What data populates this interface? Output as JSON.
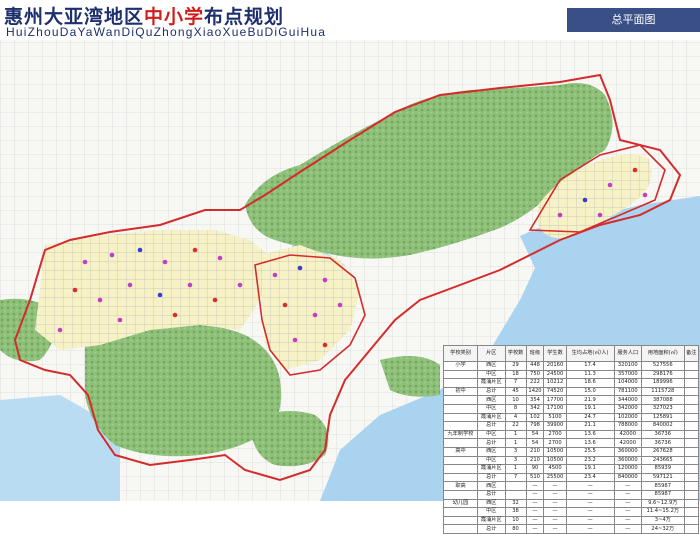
{
  "header": {
    "title_part1": "惠州大亚湾地区",
    "title_highlight": "中小学",
    "title_part2": "布点规划",
    "pinyin": "HuiZhouDaYaWanDiQuZhongXiaoXueBuDiGuiHua",
    "view_tab": "总平面图"
  },
  "colors": {
    "title": "#1e2f6e",
    "highlight": "#d21d1d",
    "boundary": "#d42b2b",
    "hills": "#7bb267",
    "water": "#a9d3ef",
    "built_area": "#f3efb1",
    "view_tab": "#3a4f86"
  },
  "legend_table": {
    "headers": [
      "学校类别",
      "片区",
      "学校数",
      "班级",
      "学生数",
      "生均占地(㎡/人)",
      "服务人口",
      "用地面积(㎡)",
      "备注"
    ],
    "rows": [
      {
        "category": "小学",
        "cells": [
          "西区",
          "29",
          "448",
          "20160",
          "17.4",
          "320100",
          "527556",
          ""
        ]
      },
      {
        "category": "",
        "cells": [
          "中区",
          "18",
          "750",
          "24500",
          "11.3",
          "357000",
          "298176",
          ""
        ]
      },
      {
        "category": "",
        "cells": [
          "霞涌片区",
          "7",
          "222",
          "10212",
          "18.6",
          "104000",
          "189996",
          ""
        ]
      },
      {
        "category": "初中",
        "cells": [
          "总计",
          "45",
          "1420",
          "74520",
          "15.0",
          "781100",
          "1115728",
          ""
        ]
      },
      {
        "category": "",
        "cells": [
          "西区",
          "10",
          "354",
          "17700",
          "21.9",
          "344000",
          "387088",
          ""
        ]
      },
      {
        "category": "",
        "cells": [
          "中区",
          "8",
          "342",
          "17100",
          "19.1",
          "342000",
          "327023",
          ""
        ]
      },
      {
        "category": "",
        "cells": [
          "霞涌片区",
          "4",
          "102",
          "5100",
          "24.7",
          "102000",
          "125891",
          ""
        ]
      },
      {
        "category": "",
        "cells": [
          "总计",
          "22",
          "798",
          "39900",
          "21.1",
          "788000",
          "840002",
          ""
        ]
      },
      {
        "category": "九年制学校",
        "cells": [
          "中区",
          "1",
          "54",
          "2700",
          "13.6",
          "42000",
          "36736",
          ""
        ]
      },
      {
        "category": "",
        "cells": [
          "总计",
          "1",
          "54",
          "2700",
          "13.6",
          "42000",
          "36736",
          ""
        ]
      },
      {
        "category": "高中",
        "cells": [
          "西区",
          "3",
          "210",
          "10500",
          "25.5",
          "360000",
          "267628",
          ""
        ]
      },
      {
        "category": "",
        "cells": [
          "中区",
          "3",
          "210",
          "10500",
          "23.2",
          "360000",
          "243665",
          ""
        ]
      },
      {
        "category": "",
        "cells": [
          "霞涌片区",
          "1",
          "90",
          "4500",
          "19.1",
          "120000",
          "85939",
          ""
        ]
      },
      {
        "category": "",
        "cells": [
          "总计",
          "7",
          "510",
          "25500",
          "23.4",
          "840000",
          "597121",
          ""
        ]
      },
      {
        "category": "职高",
        "cells": [
          "西区",
          "",
          "—",
          "—",
          "—",
          "—",
          "85987",
          ""
        ]
      },
      {
        "category": "",
        "cells": [
          "总计",
          "",
          "—",
          "—",
          "—",
          "—",
          "85987",
          ""
        ]
      },
      {
        "category": "幼儿园",
        "cells": [
          "西区",
          "32",
          "—",
          "—",
          "—",
          "—",
          "9.6~12.9万",
          ""
        ]
      },
      {
        "category": "",
        "cells": [
          "中区",
          "38",
          "—",
          "—",
          "—",
          "—",
          "11.4~15.2万",
          ""
        ]
      },
      {
        "category": "",
        "cells": [
          "霞涌片区",
          "10",
          "—",
          "—",
          "—",
          "—",
          "3~4万",
          ""
        ]
      },
      {
        "category": "",
        "cells": [
          "总计",
          "80",
          "—",
          "—",
          "—",
          "—",
          "24~32万",
          ""
        ]
      }
    ]
  }
}
